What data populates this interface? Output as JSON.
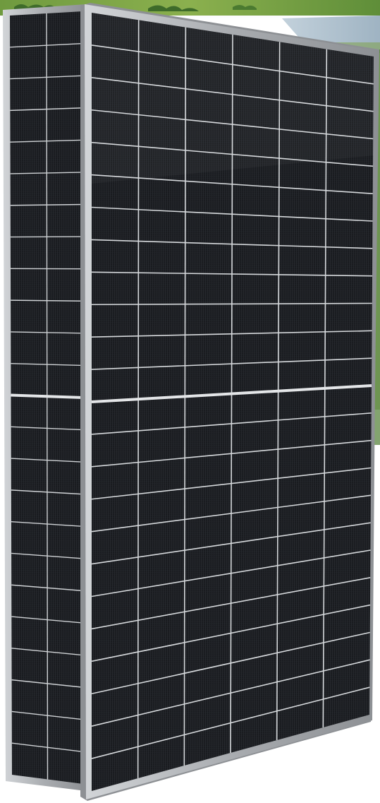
{
  "image": {
    "subject": "two-monocrystalline-half-cut-solar-panels",
    "panels": [
      {
        "id": "rear-panel",
        "cell_columns": 6,
        "cell_rows_per_half": 12,
        "halves": 2
      },
      {
        "id": "front-panel",
        "cell_columns": 6,
        "cell_rows_per_half": 12,
        "halves": 2
      }
    ],
    "colors": {
      "frame": "#b9bcbf",
      "frame_shadow": "#8d9094",
      "cell_dark": "#1b1d21",
      "cell_mid": "#25282d",
      "grid_line": "#d6d9dc",
      "background_sky": "#e9eef2",
      "background_field": "#5f8e39",
      "background_trees": "#3e6b2a",
      "background_water": "#9fb4c4"
    }
  }
}
